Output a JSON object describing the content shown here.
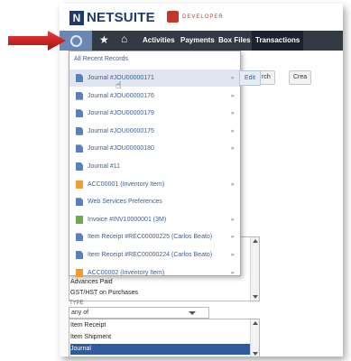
{
  "header": {
    "brand_mark": "N",
    "brand": "NETSUITE",
    "developer_label": "DEVELOPER"
  },
  "nav": {
    "items": [
      "Activities",
      "Payments",
      "Box Files",
      "Transactions"
    ],
    "active": "Transactions"
  },
  "background": {
    "search_btn_partial": "rch",
    "create_btn_partial": "Crea",
    "account_list": [
      "Advances Paid",
      "GST/HST on Purchases"
    ],
    "type_label": "TYPE",
    "type_value": "any of",
    "type_list": [
      "Item Receipt",
      "Item Shipment",
      "Journal"
    ],
    "selected_type": "Journal"
  },
  "recent": {
    "header": "All Recent Records",
    "edit_label": "Edit",
    "items": [
      {
        "label": "Journal #JOU00000171",
        "icon": "document-icon"
      },
      {
        "label": "Journal #JOU00000176",
        "icon": "document-icon"
      },
      {
        "label": "Journal #JOU00000179",
        "icon": "document-icon"
      },
      {
        "label": "Journal #JOU00000175",
        "icon": "document-icon"
      },
      {
        "label": "Journal #JOU00000180",
        "icon": "document-icon"
      },
      {
        "label": "Journal #11",
        "icon": "document-icon"
      },
      {
        "label": "ACC00001 (Inventory Item)",
        "icon": "item-icon"
      },
      {
        "label": "Web Services Preferences",
        "icon": "document-icon"
      },
      {
        "label": "Invoice #INV10000001 (3M)",
        "icon": "invoice-icon"
      },
      {
        "label": "Item Receipt #REC00000225 (Carlos Beato)",
        "icon": "document-icon"
      },
      {
        "label": "Item Receipt #REC00000224 (Carlos Beato)",
        "icon": "document-icon"
      },
      {
        "label": "ACC00002 (Inventory Item)",
        "icon": "item-icon"
      }
    ]
  },
  "colors": {
    "nav_bg": "#333a44",
    "recent_tab": "#6b87b5",
    "link": "#3d5f95",
    "selection": "#2e5aa0",
    "arrow": "#d42020"
  }
}
